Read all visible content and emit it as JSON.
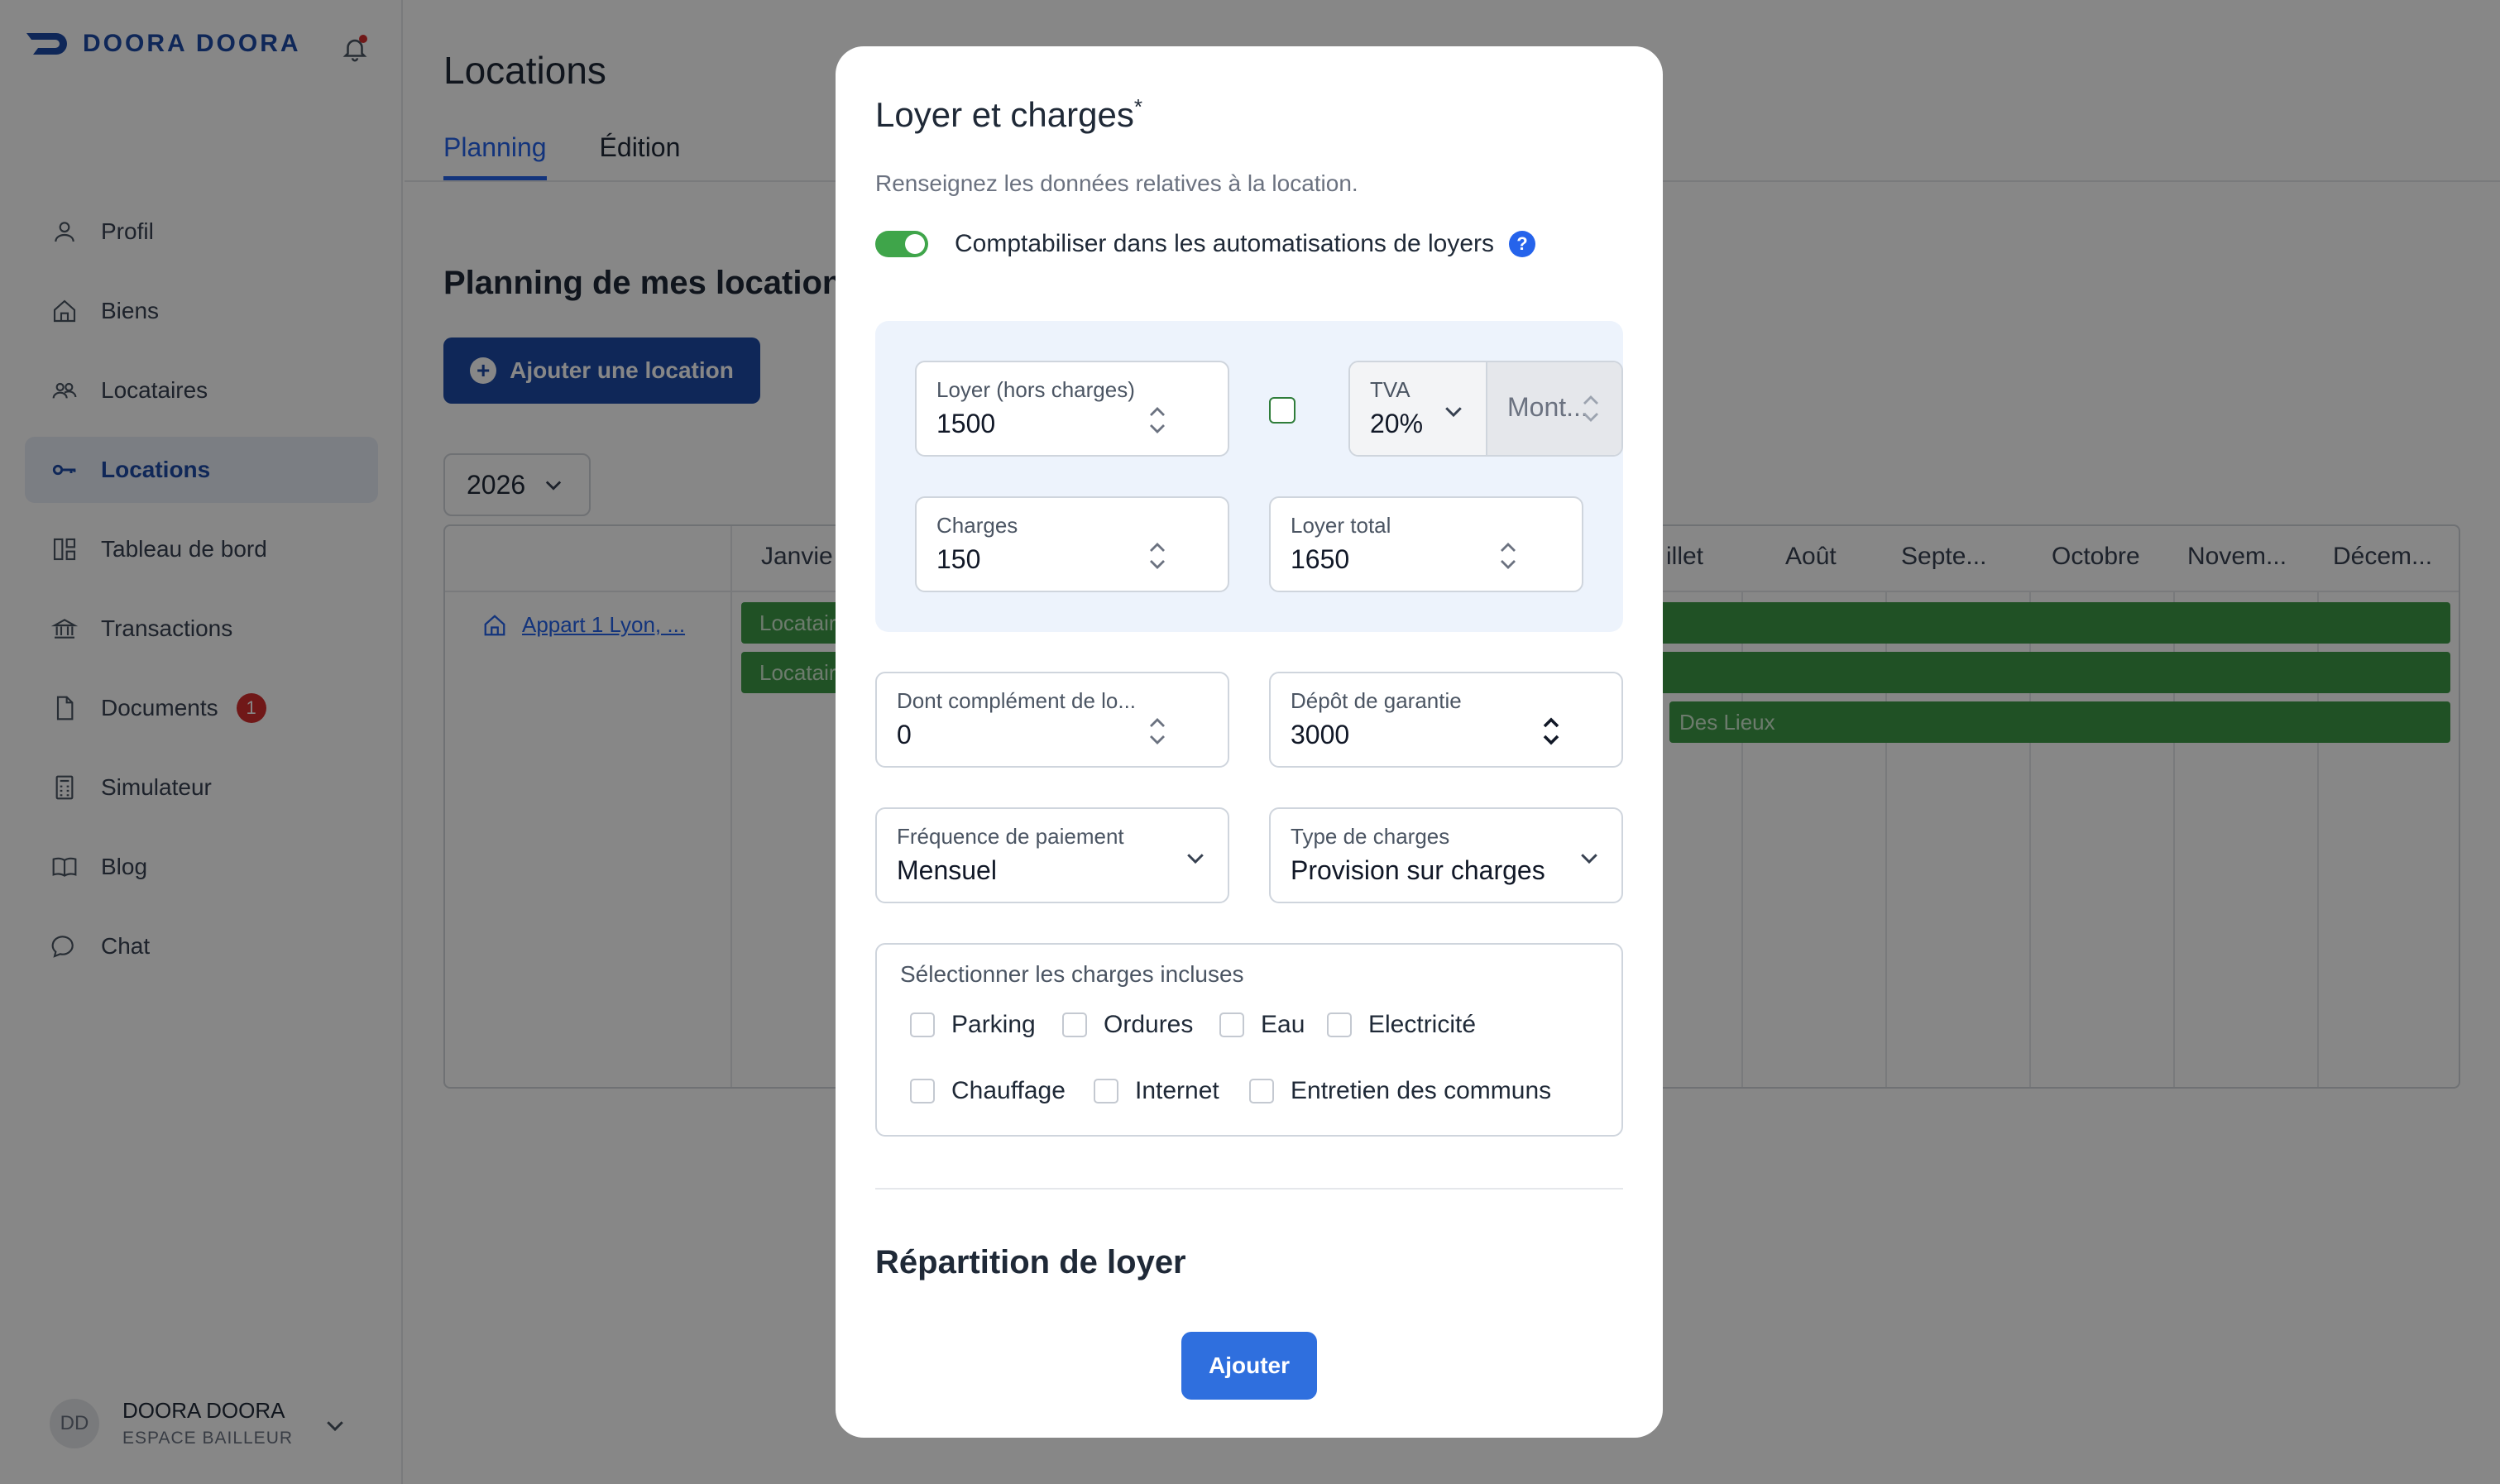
{
  "brand": {
    "name": "DOORA DOORA"
  },
  "nav": {
    "items": [
      {
        "label": "Profil",
        "icon": "user-icon"
      },
      {
        "label": "Biens",
        "icon": "home-icon"
      },
      {
        "label": "Locataires",
        "icon": "users-icon"
      },
      {
        "label": "Locations",
        "icon": "key-icon",
        "active": true
      },
      {
        "label": "Tableau de bord",
        "icon": "dashboard-icon"
      },
      {
        "label": "Transactions",
        "icon": "bank-icon"
      },
      {
        "label": "Documents",
        "icon": "document-icon",
        "badge": "1"
      },
      {
        "label": "Simulateur",
        "icon": "calculator-icon"
      },
      {
        "label": "Blog",
        "icon": "book-icon"
      },
      {
        "label": "Chat",
        "icon": "chat-icon"
      }
    ]
  },
  "user": {
    "initials": "DD",
    "name": "DOORA DOORA",
    "role": "ESPACE BAILLEUR"
  },
  "page": {
    "title": "Locations",
    "tabs": [
      {
        "label": "Planning",
        "active": true
      },
      {
        "label": "Édition"
      }
    ],
    "section_title": "Planning de mes locations",
    "add_button": "Ajouter une location",
    "year": "2026"
  },
  "calendar": {
    "months": [
      "Janvie",
      "illet",
      "Août",
      "Septe...",
      "Octobre",
      "Novem...",
      "Décem..."
    ],
    "row_label": "Appart 1 Lyon, ...",
    "bars": [
      "Locatair",
      "Locatair",
      "Des Lieux"
    ]
  },
  "modal": {
    "title": "Loyer et charges",
    "title_mark": "*",
    "subtitle": "Renseignez les données relatives à la location.",
    "toggle_label": "Comptabiliser dans les automatisations de loyers",
    "toggle_on": true,
    "help": "?",
    "loyer": {
      "label": "Loyer (hors charges)",
      "value": "1500"
    },
    "tva": {
      "label": "TVA",
      "value": "20%",
      "montant_placeholder": "Mont..."
    },
    "charges": {
      "label": "Charges",
      "value": "150"
    },
    "loyer_total": {
      "label": "Loyer total",
      "value": "1650"
    },
    "complement": {
      "label": "Dont complément de lo...",
      "value": "0"
    },
    "depot": {
      "label": "Dépôt de garantie",
      "value": "3000"
    },
    "frequence": {
      "label": "Fréquence de paiement",
      "value": "Mensuel"
    },
    "type_charges": {
      "label": "Type de charges",
      "value": "Provision sur charges"
    },
    "charges_incluses": {
      "title": "Sélectionner les charges incluses",
      "row1": [
        "Parking",
        "Ordures",
        "Eau",
        "Electricité"
      ],
      "row2": [
        "Chauffage",
        "Internet",
        "Entretien des communs"
      ]
    },
    "repartition_title": "Répartition de loyer",
    "submit": "Ajouter"
  },
  "colors": {
    "brand": "#1d4aa6",
    "accent": "#2563eb",
    "toggle": "#3fa54a",
    "bar": "#3d9a47",
    "badge": "#d32f2f"
  }
}
